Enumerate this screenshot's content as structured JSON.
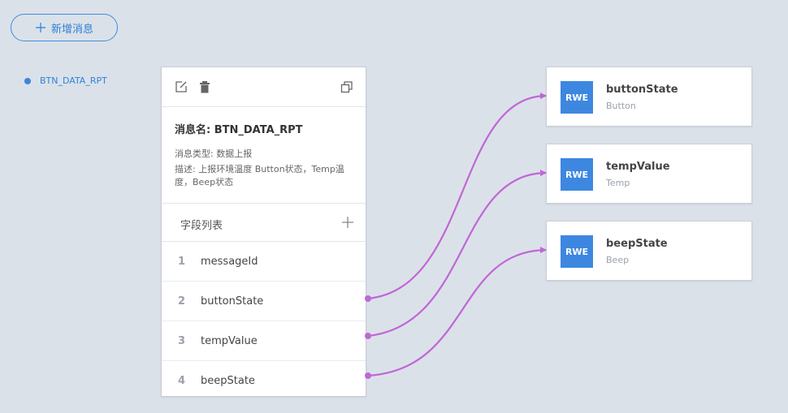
{
  "toolbar": {
    "add_message_label": "新增消息"
  },
  "message_list": [
    {
      "name": "BTN_DATA_RPT"
    }
  ],
  "message_card": {
    "name_line": "消息名: BTN_DATA_RPT",
    "type_line": "消息类型: 数据上报",
    "desc_line": "描述: 上报环境温度 Button状态，Temp温度，Beep状态",
    "fields_title": "字段列表",
    "fields": [
      {
        "num": "1",
        "name": "messageId"
      },
      {
        "num": "2",
        "name": "buttonState"
      },
      {
        "num": "3",
        "name": "tempValue"
      },
      {
        "num": "4",
        "name": "beepState"
      }
    ]
  },
  "properties": [
    {
      "badge": "RWE",
      "title": "buttonState",
      "subtitle": "Button"
    },
    {
      "badge": "RWE",
      "title": "tempValue",
      "subtitle": "Temp"
    },
    {
      "badge": "RWE",
      "title": "beepState",
      "subtitle": "Beep"
    }
  ],
  "colors": {
    "accent": "#3d87e0",
    "link": "#c066d6",
    "background": "#dbe1e9"
  },
  "icons": [
    "plus-icon",
    "edit-icon",
    "trash-icon",
    "copy-icon"
  ]
}
